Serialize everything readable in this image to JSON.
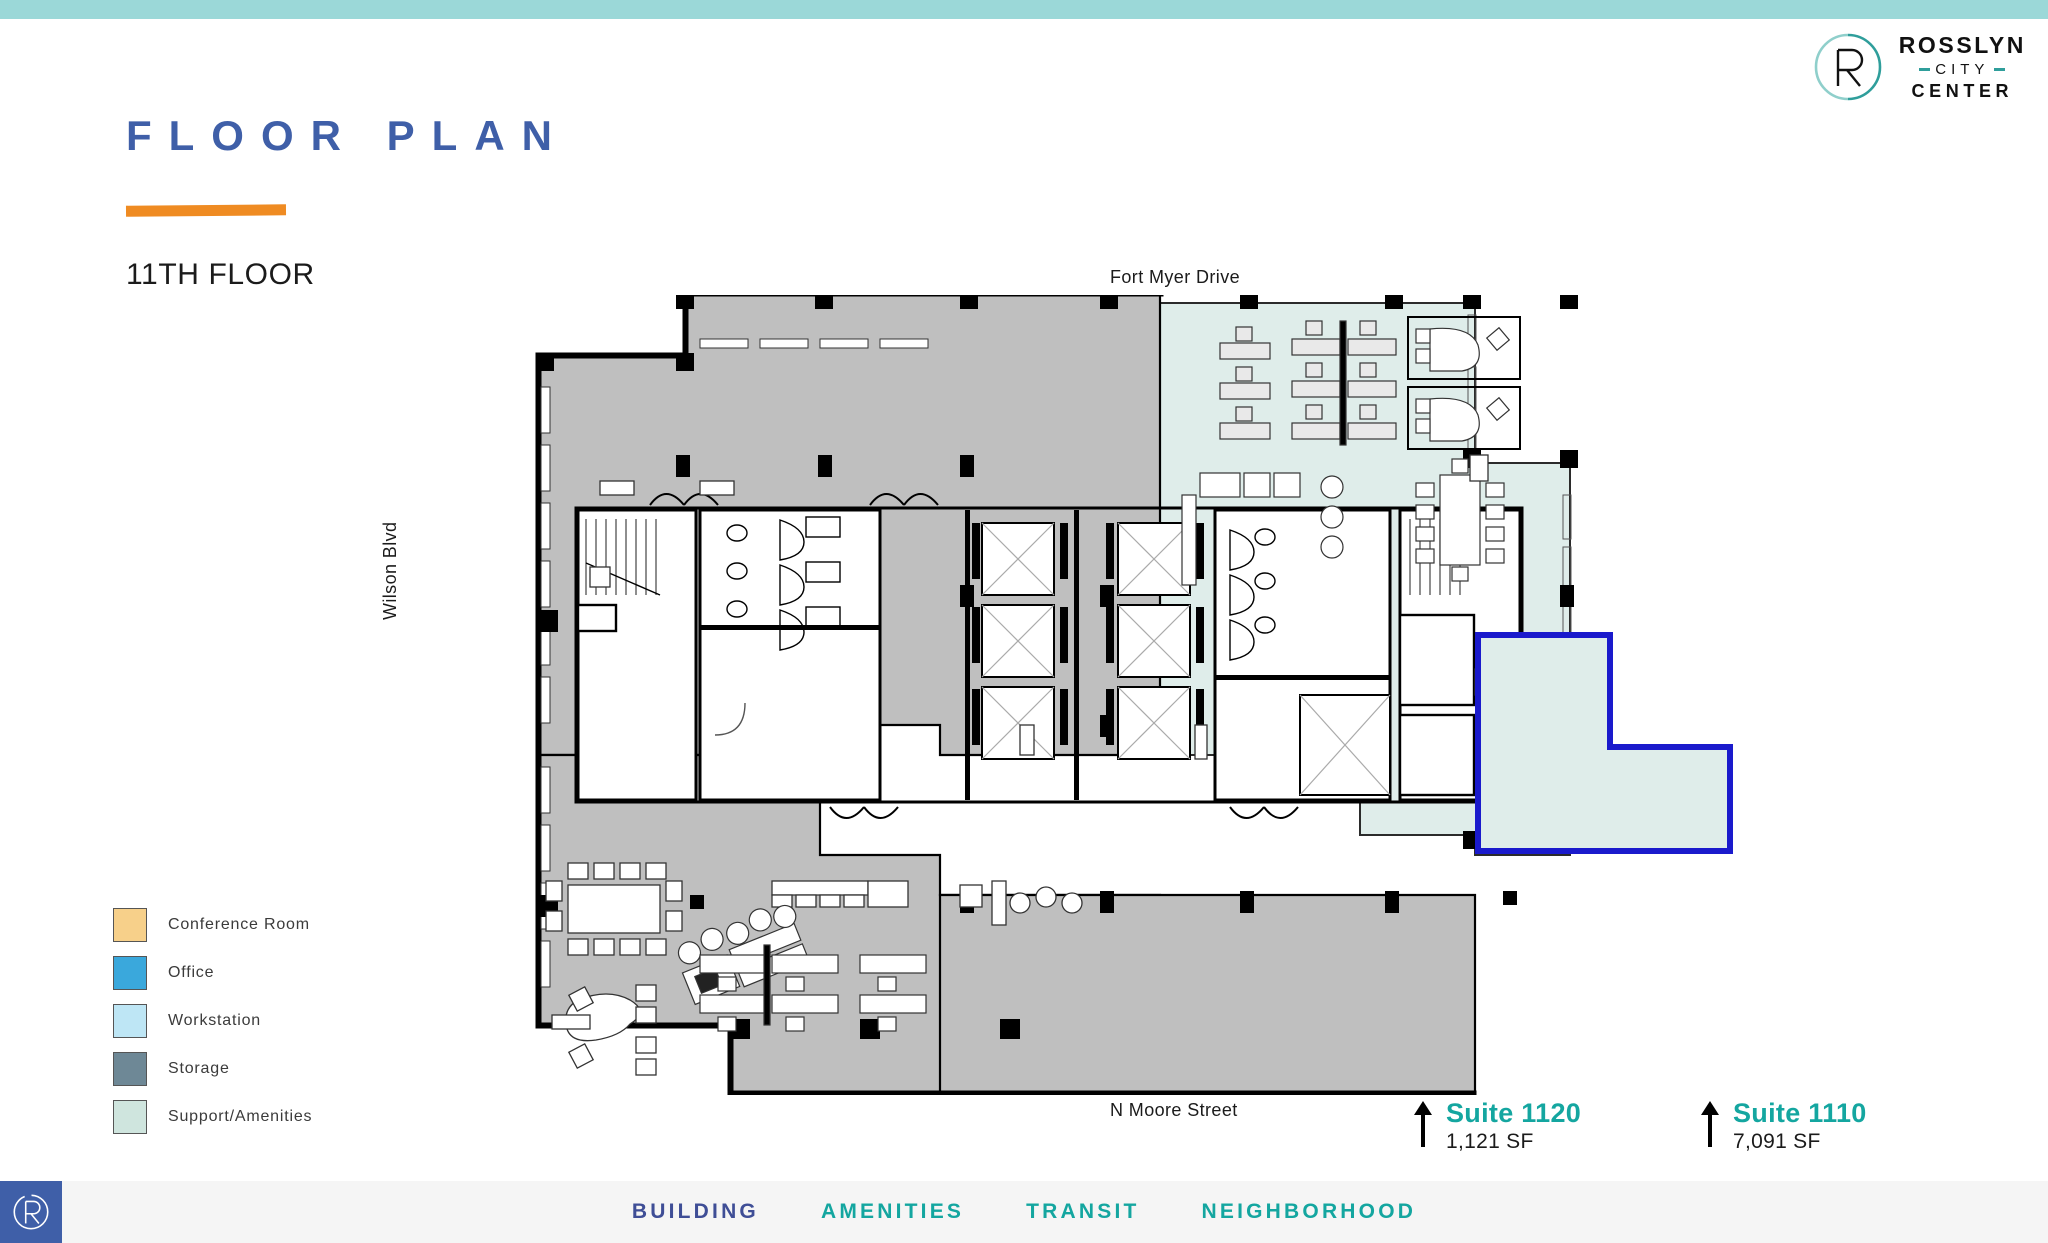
{
  "brand": {
    "line1": "ROSSLYN",
    "line2": "CITY",
    "line3": "CENTER",
    "monogram": "R"
  },
  "header": {
    "title": "FLOOR PLAN",
    "subtitle": "11TH FLOOR",
    "accent_rule_color": "#EF8B22",
    "title_color": "#3F5FA8"
  },
  "legend": {
    "items": [
      {
        "label": "Conference Room",
        "color": "#F7D08A"
      },
      {
        "label": "Office",
        "color": "#3AA8DC"
      },
      {
        "label": "Workstation",
        "color": "#BEE6F5"
      },
      {
        "label": "Storage",
        "color": "#6E8896"
      },
      {
        "label": "Support/Amenities",
        "color": "#CFE5DE"
      }
    ]
  },
  "streets": {
    "top": "Fort Myer Drive",
    "bottom": "N Moore Street",
    "left": "Wilson Blvd"
  },
  "suites": [
    {
      "id": "1120",
      "name": "Suite 1120",
      "area": "1,121 SF",
      "color": "#14A6A0",
      "outline_color": "#1A1ACC"
    },
    {
      "id": "1110",
      "name": "Suite 1110",
      "area": "7,091 SF",
      "color": "#14A6A0",
      "outline_color": "#1A1ACC"
    }
  ],
  "plan": {
    "occupied_fill": "#BFBFBF",
    "available_fill": "#DFEDEA",
    "wall_color": "#000000",
    "column_color": "#000000"
  },
  "footer": {
    "nav": [
      {
        "label": "BUILDING",
        "active": true,
        "color": "#3F4E96"
      },
      {
        "label": "AMENITIES",
        "active": false,
        "color": "#14A6A0"
      },
      {
        "label": "TRANSIT",
        "active": false,
        "color": "#14A6A0"
      },
      {
        "label": "NEIGHBORHOOD",
        "active": false,
        "color": "#14A6A0"
      }
    ],
    "logo_monogram": "R",
    "logo_bg": "#3F5FA8"
  },
  "theme": {
    "top_bar": "#9BD8D8",
    "footer_bg": "#F5F5F5"
  }
}
